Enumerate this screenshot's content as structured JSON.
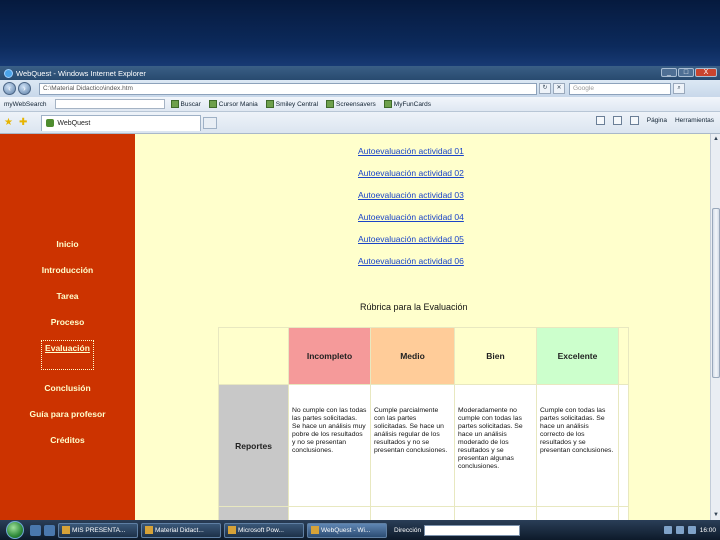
{
  "window": {
    "title": "WebQuest - Windows Internet Explorer",
    "minimize": "_",
    "maximize": "□",
    "close": "X"
  },
  "address": {
    "url": "C:\\Material Didactico\\index.htm",
    "search_placeholder": "Google"
  },
  "toolbar": {
    "brand": "myWebSearch",
    "items": [
      "Buscar",
      "Cursor Mania",
      "Smiley Central",
      "Screensavers",
      "MyFunCards"
    ]
  },
  "favbar": {
    "tab_label": "WebQuest",
    "pagina": "Página",
    "herramientas": "Herramientas"
  },
  "nav": {
    "items": [
      "Inicio",
      "Introducción",
      "Tarea",
      "Proceso",
      "Evaluación",
      "Conclusión",
      "Guía para profesor",
      "Créditos"
    ],
    "current": "Evaluación"
  },
  "links": [
    "Autoevaluación actividad 01",
    "Autoevaluación actividad 02",
    "Autoevaluación actividad 03",
    "Autoevaluación actividad 04",
    "Autoevaluación actividad 05",
    "Autoevaluación actividad 06"
  ],
  "rubric": {
    "title": "Rúbrica para la Evaluación",
    "headers": [
      "Incompleto",
      "Medio",
      "Bien",
      "Excelente"
    ],
    "rows": [
      {
        "label": "Reportes",
        "cells": [
          "No cumple con las todas las partes solicitadas. Se hace un análisis muy pobre de los resultados y no se presentan conclusiones.",
          "Cumple parcialmente con las partes solicitadas. Se hace un análisis regular de los resultados y no se presentan conclusiones.",
          "Moderadamente no cumple con todas las partes solicitadas. Se hace un análisis moderado de los resultados y se presentan algunas conclusiones.",
          "Cumple con todas las partes solicitadas. Se hace un análisis correcto de los resultados y se presentan conclusiones."
        ]
      }
    ],
    "colors": {
      "incompleto": "#f59a9a",
      "medio": "#ffcc99",
      "bien": "#ffffcc",
      "excelente": "#ccffcc"
    }
  },
  "taskbar": {
    "tasks": [
      "MIS PRESENTA...",
      "Material Didact...",
      "Microsoft Pow...",
      "WebQuest - Wi..."
    ],
    "address_label": "Dirección",
    "clock": "16:00"
  },
  "colors": {
    "nav_bg": "#cc3300",
    "page_bg": "#ffffcc",
    "link": "#1a44c8"
  }
}
